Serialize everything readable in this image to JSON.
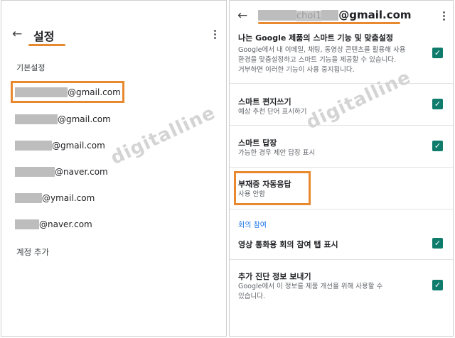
{
  "left": {
    "title": "설정",
    "section_label": "기본설정",
    "accounts": [
      {
        "visible": "@gmail.com"
      },
      {
        "visible": "@gmail.com"
      },
      {
        "visible": "@gmail.com"
      },
      {
        "visible": "@naver.com"
      },
      {
        "visible": "@ymail.com"
      },
      {
        "visible": "@naver.com"
      }
    ],
    "add_account": "계정 추가",
    "watermark": "digitalline"
  },
  "right": {
    "account_visible": "@gmail.com",
    "account_masked_partial": "choi1",
    "settings": [
      {
        "title": "나는 Google 제품의 스마트 기능 및 맞춤설정",
        "sub": [
          "Google에서 내 이메일, 채팅, 동영상 콘텐츠를 활용해 사용",
          "환경을 맞춤설정하고 스마트 기능을 제공할 수 있습니다.",
          "거부하면 이러한 기능이 사용 중지됩니다."
        ],
        "checked": true
      },
      {
        "title": "스마트 편지쓰기",
        "sub": [
          "예상 추천 단어 표시하기"
        ],
        "checked": true
      },
      {
        "title": "스마트 답장",
        "sub": [
          "가능한 경우 제안 답장 표시"
        ],
        "checked": true
      },
      {
        "title": "부재중 자동응답",
        "sub": [
          "사용 안함"
        ],
        "checked": false
      },
      {
        "title": "영상 통화용 회의 참여 탭 표시",
        "sub": [],
        "checked": true
      },
      {
        "title": "추가 진단 정보 보내기",
        "sub": [
          "Google에서 이 정보를 제품 개선을 위해 사용할 수",
          "있습니다."
        ],
        "checked": true
      }
    ],
    "group_header": "회의 참여",
    "watermark": "digitalline"
  },
  "icons": {
    "back": "arrow-back-icon",
    "menu": "more-vert-icon",
    "check": "checkbox-checked-icon"
  },
  "colors": {
    "highlight": "#e8892f",
    "checkbox": "#0f7c6b",
    "link_blue": "#1a73e8"
  }
}
